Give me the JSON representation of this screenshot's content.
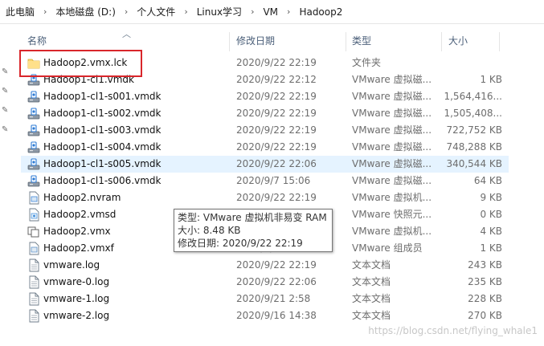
{
  "breadcrumb": [
    "此电脑",
    "本地磁盘 (D:)",
    "个人文件",
    "Linux学习",
    "VM",
    "Hadoop2"
  ],
  "columns": {
    "name": "名称",
    "date": "修改日期",
    "type": "类型",
    "size": "大小"
  },
  "files": [
    {
      "name": "Hadoop2.vmx.lck",
      "date": "2020/9/22 22:19",
      "type": "文件夹",
      "size": "",
      "icon": "folder-icon"
    },
    {
      "name": "Hadoop1-cl1.vmdk",
      "date": "2020/9/22 22:12",
      "type": "VMware 虚拟磁...",
      "size": "1 KB",
      "icon": "vmdk-icon"
    },
    {
      "name": "Hadoop1-cl1-s001.vmdk",
      "date": "2020/9/22 22:19",
      "type": "VMware 虚拟磁...",
      "size": "1,564,416...",
      "icon": "vmdk-icon"
    },
    {
      "name": "Hadoop1-cl1-s002.vmdk",
      "date": "2020/9/22 22:19",
      "type": "VMware 虚拟磁...",
      "size": "1,505,408...",
      "icon": "vmdk-icon"
    },
    {
      "name": "Hadoop1-cl1-s003.vmdk",
      "date": "2020/9/22 22:19",
      "type": "VMware 虚拟磁...",
      "size": "722,752 KB",
      "icon": "vmdk-icon"
    },
    {
      "name": "Hadoop1-cl1-s004.vmdk",
      "date": "2020/9/22 22:19",
      "type": "VMware 虚拟磁...",
      "size": "748,288 KB",
      "icon": "vmdk-icon"
    },
    {
      "name": "Hadoop1-cl1-s005.vmdk",
      "date": "2020/9/22 22:06",
      "type": "VMware 虚拟磁...",
      "size": "340,544 KB",
      "icon": "vmdk-icon"
    },
    {
      "name": "Hadoop1-cl1-s006.vmdk",
      "date": "2020/9/7 15:06",
      "type": "VMware 虚拟磁...",
      "size": "64 KB",
      "icon": "vmdk-icon"
    },
    {
      "name": "Hadoop2.nvram",
      "date": "2020/9/22 22:19",
      "type": "VMware 虚拟机...",
      "size": "9 KB",
      "icon": "nvram-icon"
    },
    {
      "name": "Hadoop2.vmsd",
      "date": "2020/9/22 22:19",
      "type": "VMware 快照元...",
      "size": "0 KB",
      "icon": "vmsd-icon"
    },
    {
      "name": "Hadoop2.vmx",
      "date": "2020/9/22 22:19",
      "type": "VMware 虚拟机...",
      "size": "4 KB",
      "icon": "vmx-icon"
    },
    {
      "name": "Hadoop2.vmxf",
      "date": "2020/9/7 15:06",
      "type": "VMware 组成员",
      "size": "1 KB",
      "icon": "vmxf-icon"
    },
    {
      "name": "vmware.log",
      "date": "2020/9/22 22:19",
      "type": "文本文档",
      "size": "243 KB",
      "icon": "log-icon"
    },
    {
      "name": "vmware-0.log",
      "date": "2020/9/22 22:06",
      "type": "文本文档",
      "size": "235 KB",
      "icon": "log-icon"
    },
    {
      "name": "vmware-1.log",
      "date": "2020/9/21 2:58",
      "type": "文本文档",
      "size": "228 KB",
      "icon": "log-icon"
    },
    {
      "name": "vmware-2.log",
      "date": "2020/9/16 14:38",
      "type": "文本文档",
      "size": "270 KB",
      "icon": "log-icon"
    }
  ],
  "selected_row": 6,
  "tooltip": {
    "line1": "类型: VMware 虚拟机非易变 RAM",
    "line2": "大小: 8.48 KB",
    "line3": "修改日期: 2020/9/22 22:19"
  },
  "watermark": "https://blog.csdn.net/flying_whale1",
  "colors": {
    "highlight_box": "#d9262b",
    "selected": "#cce8ff",
    "header_text": "#4c607a"
  }
}
